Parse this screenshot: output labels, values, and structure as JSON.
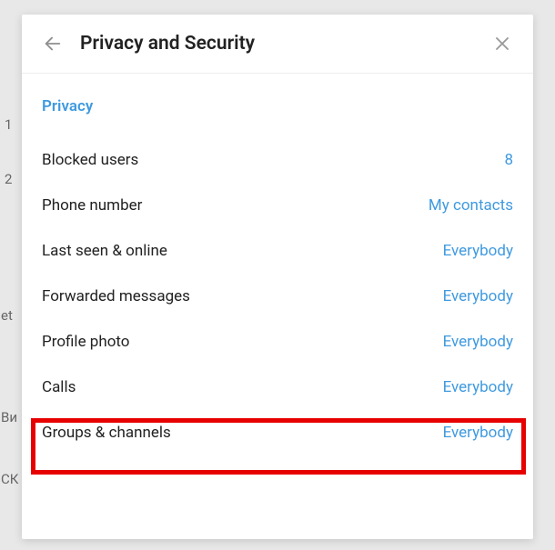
{
  "header": {
    "title": "Privacy and Security"
  },
  "section": {
    "title": "Privacy"
  },
  "rows": [
    {
      "label": "Blocked users",
      "value": "8"
    },
    {
      "label": "Phone number",
      "value": "My contacts"
    },
    {
      "label": "Last seen & online",
      "value": "Everybody"
    },
    {
      "label": "Forwarded messages",
      "value": "Everybody"
    },
    {
      "label": "Profile photo",
      "value": "Everybody"
    },
    {
      "label": "Calls",
      "value": "Everybody"
    },
    {
      "label": "Groups & channels",
      "value": "Everybody"
    }
  ],
  "background": {
    "snippet1": "1",
    "snippet2": "2",
    "snippet3": "et",
    "snippet4": "Ви",
    "snippet5": "СК"
  }
}
